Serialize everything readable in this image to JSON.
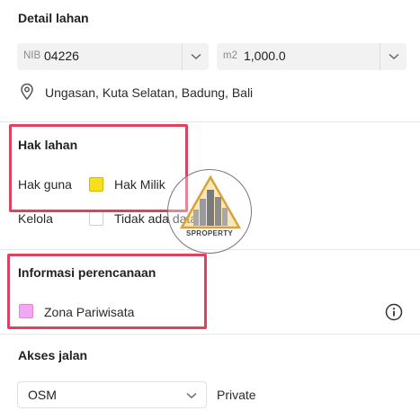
{
  "detail": {
    "title": "Detail lahan",
    "nib": {
      "prefix": "NIB",
      "value": "04226"
    },
    "area": {
      "prefix": "m2",
      "value": "1,000.0"
    },
    "location": "Ungasan, Kuta Selatan, Badung, Bali"
  },
  "hak_lahan": {
    "title": "Hak lahan",
    "rows": [
      {
        "label": "Hak guna",
        "option": "Hak Milik",
        "color": "#f7df1e",
        "checked": true
      },
      {
        "label": "Kelola",
        "option": "Tidak ada data",
        "color": "#ffffff",
        "checked": false
      }
    ]
  },
  "perencanaan": {
    "title": "Informasi perencanaan",
    "zona": {
      "label": "Zona Pariwisata",
      "color": "#f3a6f3"
    }
  },
  "akses": {
    "title": "Akses jalan",
    "select_value": "OSM",
    "status": "Private"
  },
  "watermark": {
    "brand": "SPROPERTY"
  },
  "icons": [
    "chevron-down-icon",
    "location-pin-icon",
    "info-icon"
  ],
  "colors": {
    "highlight": "#e0415e"
  }
}
